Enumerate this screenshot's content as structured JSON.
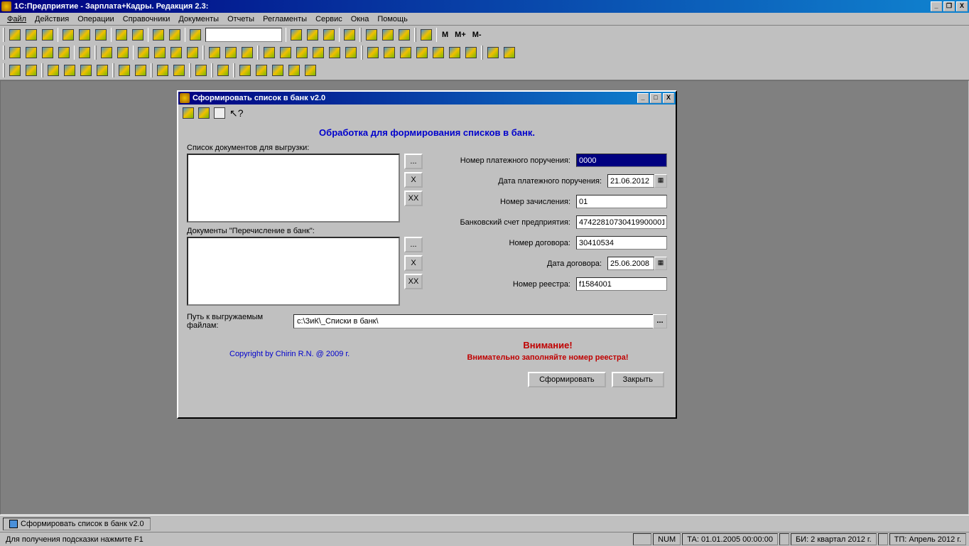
{
  "app": {
    "title": "1С:Предприятие - Зарплата+Кадры. Редакция 2.3:"
  },
  "menus": [
    "Файл",
    "Действия",
    "Операции",
    "Справочники",
    "Документы",
    "Отчеты",
    "Регламенты",
    "Сервис",
    "Окна",
    "Помощь"
  ],
  "memory_btns": [
    "M",
    "M+",
    "M-"
  ],
  "dialog": {
    "title": "Сформировать список в банк v2.0",
    "heading": "Обработка для формирования списков в банк.",
    "list1_label": "Список документов для выгрузки:",
    "list2_label": "Документы \"Перечисление в банк\":",
    "btn_browse": "...",
    "btn_del": "X",
    "btn_delall": "XX",
    "fields": {
      "payorder_no_label": "Номер платежного поручения:",
      "payorder_no": "0000",
      "payorder_date_label": "Дата платежного поручения:",
      "payorder_date": "21.06.2012",
      "credit_no_label": "Номер зачисления:",
      "credit_no": "01",
      "bank_acc_label": "Банковский счет предприятия:",
      "bank_acc": "47422810730419900001",
      "contract_no_label": "Номер договора:",
      "contract_no": "30410534",
      "contract_date_label": "Дата договора:",
      "contract_date": "25.06.2008",
      "registry_no_label": "Номер реестра:",
      "registry_no": "f1584001"
    },
    "path_label": "Путь к выгружаемым файлам:",
    "path_value": "c:\\ЗиК\\_Списки в банк\\",
    "copyright": "Copyright by Chirin R.N. @ 2009 г.",
    "warning_title": "Внимание!",
    "warning_text": "Внимательно заполняйте номер реестра!",
    "btn_form": "Сформировать",
    "btn_close": "Закрыть"
  },
  "taskbar_item": "Сформировать список в банк v2.0",
  "status": {
    "hint": "Для получения подсказки нажмите F1",
    "num": "NUM",
    "ta": "ТА: 01.01.2005  00:00:00",
    "bi": "БИ: 2 квартал 2012 г.",
    "tp": "ТП: Апрель 2012 г."
  }
}
